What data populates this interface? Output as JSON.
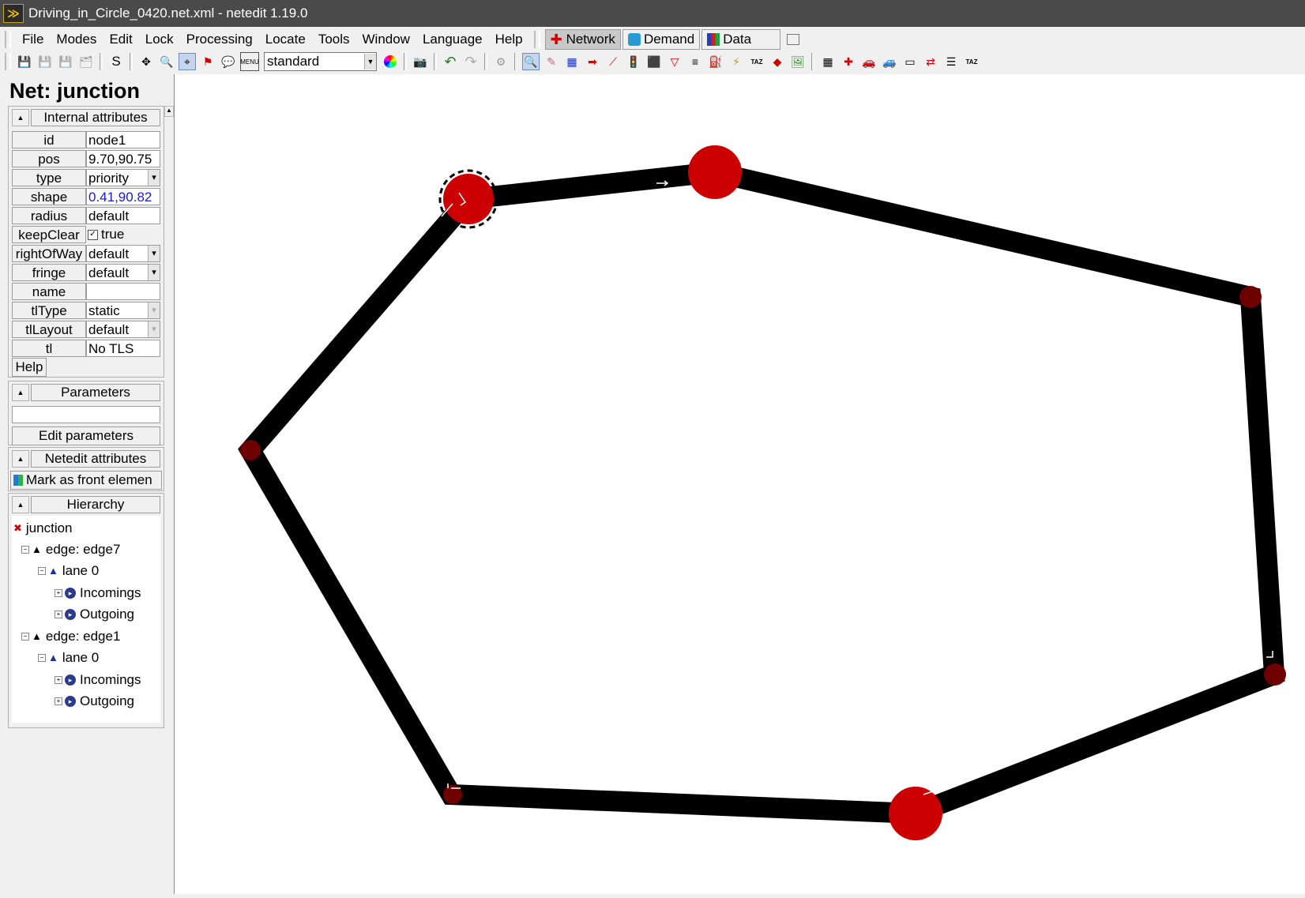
{
  "window": {
    "title": "Driving_in_Circle_0420.net.xml - netedit 1.19.0"
  },
  "menu": {
    "items": [
      "File",
      "Modes",
      "Edit",
      "Lock",
      "Processing",
      "Locate",
      "Tools",
      "Window",
      "Language",
      "Help"
    ],
    "supermodes": [
      "Network",
      "Demand",
      "Data"
    ]
  },
  "toolbar": {
    "s_label": "S",
    "scheme": "standard"
  },
  "panel": {
    "title": "Net: junction",
    "internal_header": "Internal attributes",
    "attributes": [
      {
        "name": "id",
        "value": "node1"
      },
      {
        "name": "pos",
        "value": "9.70,90.75"
      },
      {
        "name": "type",
        "value": "priority"
      },
      {
        "name": "shape",
        "value": "0.41,90.82"
      },
      {
        "name": "radius",
        "value": "default"
      },
      {
        "name": "keepClear",
        "value": "true"
      },
      {
        "name": "rightOfWay",
        "value": "default"
      },
      {
        "name": "fringe",
        "value": "default"
      },
      {
        "name": "name",
        "value": ""
      },
      {
        "name": "tlType",
        "value": "static"
      },
      {
        "name": "tlLayout",
        "value": "default"
      },
      {
        "name": "tl",
        "value": "No TLS"
      }
    ],
    "help_label": "Help",
    "parameters_header": "Parameters",
    "edit_parameters_label": "Edit parameters",
    "netedit_header": "Netedit attributes",
    "mark_front_label": "Mark as front elemen",
    "hierarchy_header": "Hierarchy",
    "hierarchy": {
      "root": "junction",
      "edge_a": "edge: edge7",
      "lane_a": "lane 0",
      "incomings_a": "Incomings",
      "outgoing_a": "Outgoing",
      "edge_b": "edge: edge1",
      "lane_b": "lane 0",
      "incomings_b": "Incomings",
      "outgoing_b": "Outgoing"
    }
  },
  "colors": {
    "road": "#000000",
    "junction": "#cc0000",
    "junction_small": "#6e0000",
    "selection_ring": "#000000"
  }
}
